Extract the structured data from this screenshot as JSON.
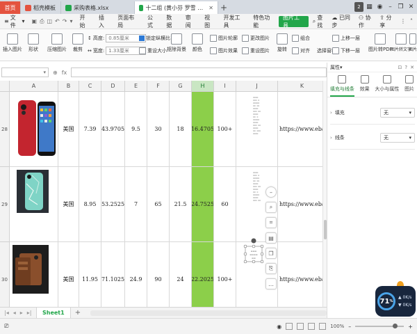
{
  "tabs": [
    {
      "label": "首页"
    },
    {
      "label": "稻壳模板"
    },
    {
      "label": "采购表格.xlsx"
    },
    {
      "label": "十二组 (黄小芬 罗雪 刘成阳) .xlsx"
    }
  ],
  "window": {
    "badge": "2"
  },
  "menu": {
    "file": "文件",
    "items": [
      "开始",
      "插入",
      "页面布局",
      "公式",
      "数据",
      "审阅",
      "视图",
      "开发工具",
      "特色功能",
      "图片工具"
    ],
    "active_index": 9,
    "search": "查找",
    "sync": "已同步",
    "collab": "协作",
    "share": "分享"
  },
  "ribbon": {
    "insert_image": "插入图片",
    "shape": "形状",
    "compress": "压缩图片",
    "crop": "裁剪",
    "height_label": "高度:",
    "height_value": "0.85厘米",
    "width_label": "宽度:",
    "width_value": "1.33厘米",
    "lock_ratio": "锁定纵横比",
    "reset_size": "重设大小",
    "remove_bg": "抠除背景",
    "color": "颜色",
    "image_outline": "图片轮廓",
    "image_effect": "图片效果",
    "change_image": "更改图片",
    "reset_image": "重设图片",
    "rotate": "旋转",
    "combine": "组合",
    "align": "对齐",
    "bring_forward": "上移一层",
    "send_backward": "下移一层",
    "selection_pane": "选择窗格",
    "to_pdf": "图片转PDF",
    "to_text": "图片转文字",
    "print": "图片"
  },
  "columns": [
    "A",
    "B",
    "C",
    "D",
    "E",
    "F",
    "G",
    "H",
    "I",
    "J",
    "K"
  ],
  "selected_column": "H",
  "rows": [
    {
      "num": "28",
      "cells": [
        "",
        "美国",
        "7.39",
        "43.9705",
        "9.5",
        "30",
        "18",
        "16.4705",
        "100+",
        "",
        "https://www.ebay."
      ]
    },
    {
      "num": "29",
      "cells": [
        "",
        "美国",
        "8.95",
        "53.2525",
        "7",
        "65",
        "21.5",
        "24.7525",
        "60",
        "",
        "https://www.ebay."
      ]
    },
    {
      "num": "30",
      "cells": [
        "",
        "美国",
        "11.95",
        "71.1025",
        "24.9",
        "90",
        "24",
        "22.2025",
        "100+",
        "",
        "https://www.ebay."
      ]
    }
  ],
  "sheet": {
    "active": "Sheet1"
  },
  "status": {
    "zoom": "100%"
  },
  "panel": {
    "title": "属性",
    "tabs": [
      "填充与线条",
      "效果",
      "大小与属性",
      "图片"
    ],
    "fill_label": "填充",
    "fill_value": "无",
    "line_label": "线条",
    "line_value": "无"
  },
  "widget": {
    "percent": "71",
    "percent_unit": "%",
    "up_rate": "0K/s",
    "down_rate": "0K/s"
  },
  "colors": {
    "accent": "#22a64a",
    "highlight": "#8ccf4a",
    "home_tab": "#e4533f"
  }
}
